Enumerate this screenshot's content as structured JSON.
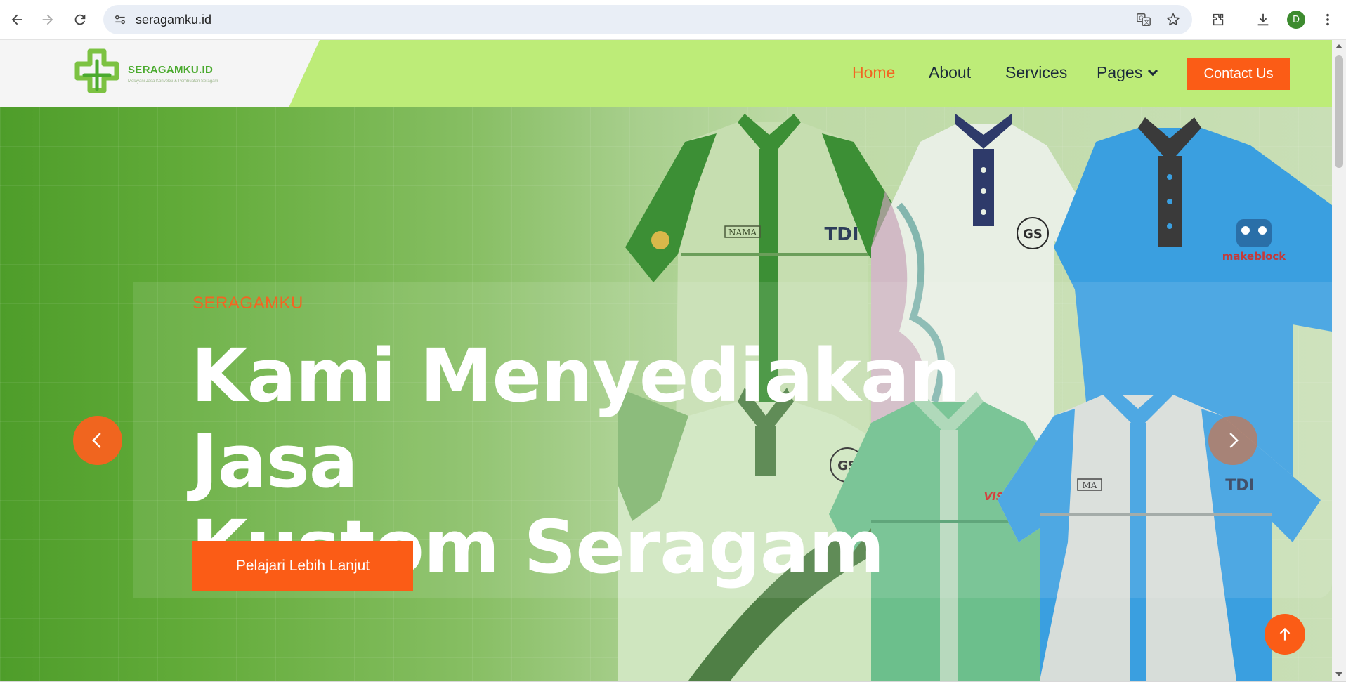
{
  "browser": {
    "url": "seragamku.id",
    "profile_initial": "D",
    "icons": [
      "back-icon",
      "forward-icon",
      "reload-icon",
      "site-info-icon",
      "translate-icon",
      "star-icon",
      "extensions-icon",
      "download-icon",
      "menu-icon"
    ]
  },
  "header": {
    "logo_name": "SERAGAMKU.ID",
    "logo_tagline": "Melayani Jasa Konveksi & Pembuatan Seragam",
    "nav": {
      "home": "Home",
      "about": "About",
      "services": "Services",
      "pages": "Pages"
    },
    "contact_label": "Contact Us"
  },
  "hero": {
    "eyebrow": "SERAGAMKU",
    "title_line1": "Kami Menyediakan Jasa",
    "title_line2": "Kustom Seragam",
    "cta_label": "Pelajari Lebih Lanjut",
    "shirt_labels": {
      "name_tag": "NAMA",
      "brand_tdi": "TDI",
      "brand_visipro": "VISIPRO",
      "brand_makeblock": "makeblock",
      "name_tag_2": "MA",
      "brand_tdi_2": "TDI"
    }
  },
  "colors": {
    "accent": "#fb5c16",
    "header_green": "#bdec78",
    "hero_green": "#4e9d2a",
    "nav_text": "#1b2a3a"
  }
}
